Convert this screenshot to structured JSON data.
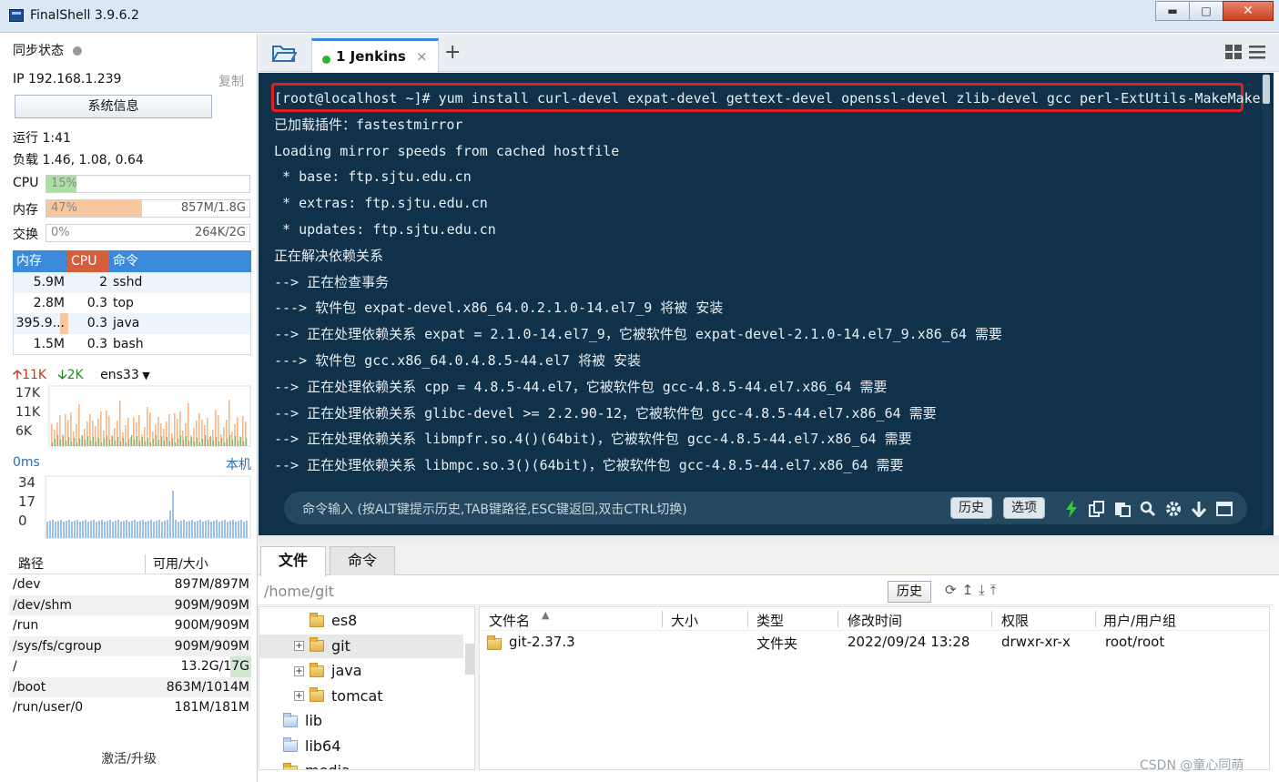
{
  "app": {
    "title": "FinalShell 3.9.6.2"
  },
  "sidebar": {
    "sync_label": "同步状态",
    "ip": "IP 192.168.1.239",
    "copy_label": "复制",
    "sysinfo_label": "系统信息",
    "uptime": "运行 1:41",
    "load": "负载 1.46, 1.08, 0.64",
    "meters": [
      {
        "label": "CPU",
        "pct_text": "15%",
        "cap": "",
        "fraction": 0.15,
        "color": "#a8e0a0"
      },
      {
        "label": "内存",
        "pct_text": "47%",
        "cap": "857M/1.8G",
        "fraction": 0.47,
        "color": "#f7c8a0"
      },
      {
        "label": "交换",
        "pct_text": "0%",
        "cap": "264K/2G",
        "fraction": 0.0,
        "color": "#d8d8d8"
      }
    ],
    "proc_head": {
      "mem": "内存",
      "cpu": "CPU",
      "cmd": "命令"
    },
    "procs": [
      {
        "mem": "5.9M",
        "cpu": "2",
        "cmd": "sshd"
      },
      {
        "mem": "2.8M",
        "cpu": "0.3",
        "cmd": "top"
      },
      {
        "mem": "395.9...",
        "cpu": "0.3",
        "cmd": "java"
      },
      {
        "mem": "1.5M",
        "cpu": "0.3",
        "cmd": "bash"
      }
    ],
    "net": {
      "up": "11K",
      "down": "2K",
      "iface": "ens33",
      "ticks": [
        "17K",
        "11K",
        "6K"
      ]
    },
    "ping": {
      "label": "0ms",
      "local": "本机",
      "ticks": [
        "34",
        "17",
        "0"
      ]
    },
    "disk_head": {
      "path": "路径",
      "size": "可用/大小"
    },
    "disks": [
      {
        "path": "/dev",
        "size": "897M/897M"
      },
      {
        "path": "/dev/shm",
        "size": "909M/909M"
      },
      {
        "path": "/run",
        "size": "900M/909M"
      },
      {
        "path": "/sys/fs/cgroup",
        "size": "909M/909M"
      },
      {
        "path": "/",
        "size": "13.2G/17G"
      },
      {
        "path": "/boot",
        "size": "863M/1014M"
      },
      {
        "path": "/run/user/0",
        "size": "181M/181M"
      }
    ],
    "activate_label": "激活/升级"
  },
  "tabs": {
    "session_name": "1 Jenkins",
    "close": "×",
    "add": "+"
  },
  "terminal": {
    "lines": [
      "[root@localhost ~]# yum install curl-devel expat-devel gettext-devel openssl-devel zlib-devel gcc perl-ExtUtils-MakeMaker",
      "已加载插件：fastestmirror",
      "Loading mirror speeds from cached hostfile",
      " * base: ftp.sjtu.edu.cn",
      " * extras: ftp.sjtu.edu.cn",
      " * updates: ftp.sjtu.edu.cn",
      "正在解决依赖关系",
      "--> 正在检查事务",
      "---> 软件包 expat-devel.x86_64.0.2.1.0-14.el7_9 将被 安装",
      "--> 正在处理依赖关系 expat = 2.1.0-14.el7_9，它被软件包 expat-devel-2.1.0-14.el7_9.x86_64 需要",
      "---> 软件包 gcc.x86_64.0.4.8.5-44.el7 将被 安装",
      "--> 正在处理依赖关系 cpp = 4.8.5-44.el7，它被软件包 gcc-4.8.5-44.el7.x86_64 需要",
      "--> 正在处理依赖关系 glibc-devel >= 2.2.90-12，它被软件包 gcc-4.8.5-44.el7.x86_64 需要",
      "--> 正在处理依赖关系 libmpfr.so.4()(64bit)，它被软件包 gcc-4.8.5-44.el7.x86_64 需要",
      "--> 正在处理依赖关系 libmpc.so.3()(64bit)，它被软件包 gcc-4.8.5-44.el7.x86_64 需要"
    ],
    "input_placeholder": "命令输入 (按ALT键提示历史,TAB键路径,ESC键返回,双击CTRL切换)",
    "history_label": "历史",
    "options_label": "选项"
  },
  "filemanager": {
    "tab_files": "文件",
    "tab_cmds": "命令",
    "path": "/home/git",
    "history_label": "历史",
    "tree": [
      {
        "name": "es8",
        "level": 2,
        "expandable": false,
        "selected": false,
        "color": "yellow"
      },
      {
        "name": "git",
        "level": 2,
        "expandable": true,
        "selected": true,
        "color": "yellow"
      },
      {
        "name": "java",
        "level": 2,
        "expandable": true,
        "selected": false,
        "color": "yellow"
      },
      {
        "name": "tomcat",
        "level": 2,
        "expandable": true,
        "selected": false,
        "color": "yellow"
      },
      {
        "name": "lib",
        "level": 1,
        "expandable": false,
        "selected": false,
        "color": "blue"
      },
      {
        "name": "lib64",
        "level": 1,
        "expandable": false,
        "selected": false,
        "color": "blue"
      },
      {
        "name": "media",
        "level": 1,
        "expandable": false,
        "selected": false,
        "color": "yellow"
      }
    ],
    "columns": {
      "name": "文件名",
      "size": "大小",
      "type": "类型",
      "mtime": "修改时间",
      "perm": "权限",
      "owner": "用户/用户组"
    },
    "file": {
      "name": "git-2.37.3",
      "size": "",
      "type": "文件夹",
      "mtime": "2022/09/24 13:28",
      "perm": "drwxr-xr-x",
      "owner": "root/root"
    }
  },
  "watermark": "CSDN @童心同萌"
}
